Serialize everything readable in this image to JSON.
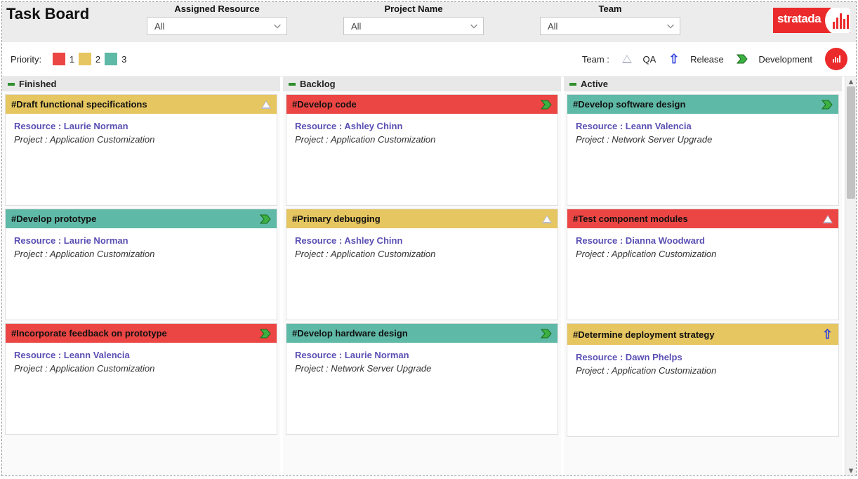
{
  "header": {
    "title": "Task Board",
    "filters": [
      {
        "label": "Assigned Resource",
        "value": "All"
      },
      {
        "label": "Project Name",
        "value": "All"
      },
      {
        "label": "Team",
        "value": "All"
      }
    ],
    "logo_text": "stratada"
  },
  "legend": {
    "priority_label": "Priority:",
    "priorities": [
      {
        "num": "1",
        "color": "#eb4644"
      },
      {
        "num": "2",
        "color": "#e6c660"
      },
      {
        "num": "3",
        "color": "#5fb9a7"
      }
    ],
    "team_label": "Team :",
    "teams": [
      {
        "name": "QA",
        "icon": "triangle"
      },
      {
        "name": "Release",
        "icon": "arrow-up"
      },
      {
        "name": "Development",
        "icon": "chevron-right"
      }
    ]
  },
  "columns": [
    {
      "name": "Finished",
      "cards": [
        {
          "title": "#Draft functional specifications",
          "priority": 2,
          "team": "QA",
          "resource": "Resource : Laurie Norman",
          "project": "Project : Application Customization"
        },
        {
          "title": "#Develop prototype",
          "priority": 3,
          "team": "Development",
          "resource": "Resource : Laurie Norman",
          "project": "Project : Application Customization"
        },
        {
          "title": "#Incorporate feedback on prototype",
          "priority": 1,
          "team": "Development",
          "resource": "Resource : Leann Valencia",
          "project": "Project : Application Customization"
        }
      ]
    },
    {
      "name": "Backlog",
      "cards": [
        {
          "title": "#Develop code",
          "priority": 1,
          "team": "Development",
          "resource": "Resource : Ashley Chinn",
          "project": "Project : Application Customization"
        },
        {
          "title": "#Primary debugging",
          "priority": 2,
          "team": "QA",
          "resource": "Resource : Ashley Chinn",
          "project": "Project : Application Customization"
        },
        {
          "title": "#Develop hardware design",
          "priority": 3,
          "team": "Development",
          "resource": "Resource : Laurie Norman",
          "project": "Project : Network Server Upgrade"
        }
      ]
    },
    {
      "name": "Active",
      "cards": [
        {
          "title": "#Develop software design",
          "priority": 3,
          "team": "Development",
          "resource": "Resource : Leann Valencia",
          "project": "Project : Network Server Upgrade"
        },
        {
          "title": "#Test component modules",
          "priority": 1,
          "team": "QA",
          "resource": "Resource : Dianna Woodward",
          "project": "Project : Application Customization"
        },
        {
          "title": "#Determine deployment strategy",
          "priority": 2,
          "team": "Release",
          "resource": "Resource : Dawn Phelps",
          "project": "Project : Application Customization"
        }
      ]
    }
  ]
}
